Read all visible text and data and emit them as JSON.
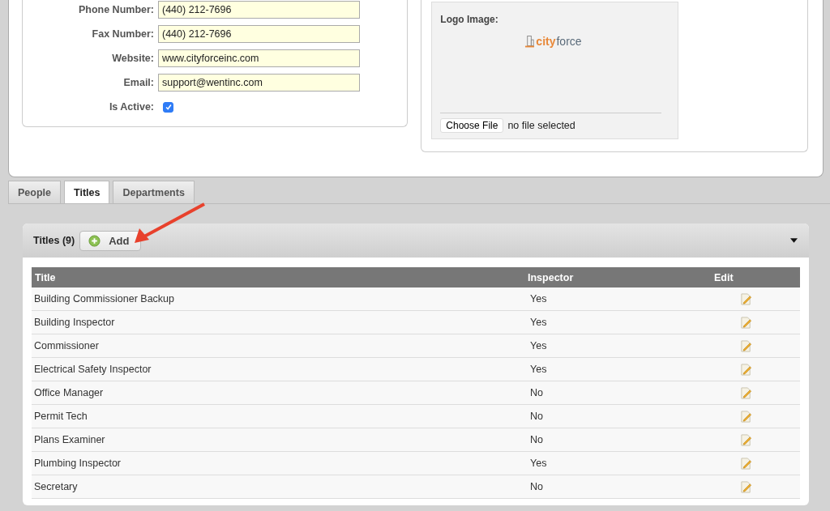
{
  "form": {
    "fields": [
      {
        "label": "Phone Number:",
        "value": "(440) 212-7696"
      },
      {
        "label": "Fax Number:",
        "value": "(440) 212-7696"
      },
      {
        "label": "Website:",
        "value": "www.cityforceinc.com"
      },
      {
        "label": "Email:",
        "value": "support@wentinc.com"
      }
    ],
    "is_active": {
      "label": "Is Active:",
      "checked": true
    }
  },
  "logo": {
    "label": "Logo Image:",
    "logo_text_1": "city",
    "logo_text_2": "force",
    "choose_button": "Choose File",
    "file_status": "no file selected"
  },
  "tabs": [
    {
      "label": "People",
      "selected": false
    },
    {
      "label": "Titles",
      "selected": true
    },
    {
      "label": "Departments",
      "selected": false
    }
  ],
  "titles_panel": {
    "heading": "Titles (9)",
    "add_button": "Add",
    "expanded": true
  },
  "table": {
    "columns": [
      "Title",
      "Inspector",
      "Edit"
    ],
    "rows": [
      {
        "title": "Building Commissioner Backup",
        "inspector": "Yes"
      },
      {
        "title": "Building Inspector",
        "inspector": "Yes"
      },
      {
        "title": "Commissioner",
        "inspector": "Yes"
      },
      {
        "title": "Electrical Safety Inspector",
        "inspector": "Yes"
      },
      {
        "title": "Office Manager",
        "inspector": "No"
      },
      {
        "title": "Permit Tech",
        "inspector": "No"
      },
      {
        "title": "Plans Examiner",
        "inspector": "No"
      },
      {
        "title": "Plumbing Inspector",
        "inspector": "Yes"
      },
      {
        "title": "Secretary",
        "inspector": "No"
      }
    ]
  }
}
